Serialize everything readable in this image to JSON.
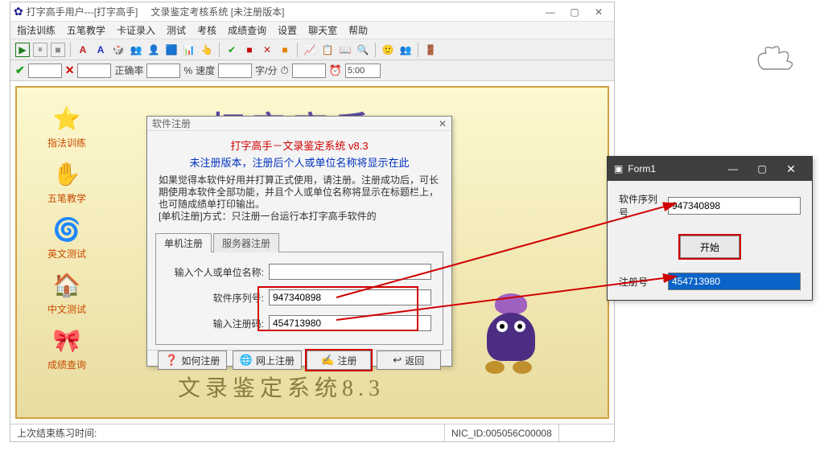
{
  "window": {
    "title1": "打字高手用户---[打字高手]",
    "title2": "文录鉴定考核系统  [未注册版本]"
  },
  "menu": [
    "指法训练",
    "五笔教学",
    "卡证录入",
    "测试",
    "考核",
    "成绩查询",
    "设置",
    "聊天室",
    "帮助"
  ],
  "stat": {
    "rate_label": "正确率",
    "pct": "%",
    "speed_label": "速度",
    "unit": "字/分",
    "timer": "5:00"
  },
  "sidebar": {
    "items": [
      {
        "icon": "⭐",
        "label": "指法训练"
      },
      {
        "icon": "✋",
        "label": "五笔教学"
      },
      {
        "icon": "🌀",
        "label": "英文测试"
      },
      {
        "icon": "🏠",
        "label": "中文测试"
      },
      {
        "icon": "🎀",
        "label": "成绩查询"
      }
    ]
  },
  "decor": {
    "big_title": "打字高手",
    "sub_title": "文录鉴定系统8.3"
  },
  "dialog": {
    "caption": "软件注册",
    "h1": "打字高手－文录鉴定系统 v8.3",
    "h2": "未注册版本，注册后个人或单位名称将显示在此",
    "para": "如果觉得本软件好用并打算正式使用，请注册。注册成功后，可长期使用本软件全部功能，并且个人或单位名称将显示在标题栏上，也可随成绩单打印输出。\n[单机注册]方式：只注册一台运行本打字高手软件的",
    "tabs": [
      "单机注册",
      "服务器注册"
    ],
    "label_name": "输入个人或单位名称:",
    "label_serial": "软件序列号:",
    "label_code": "输入注册码:",
    "serial": "947340898",
    "code": "454713980",
    "name": "",
    "btn_how": "如何注册",
    "btn_online": "网上注册",
    "btn_reg": "注册",
    "btn_back": "返回"
  },
  "status": {
    "left": "上次结束练习时间:",
    "nic": "NIC_ID:005056C00008"
  },
  "form1": {
    "title": "Form1",
    "label_serial": "软件序列号",
    "serial": "947340898",
    "start": "开始",
    "label_code": "注册号",
    "code": "454713980"
  }
}
